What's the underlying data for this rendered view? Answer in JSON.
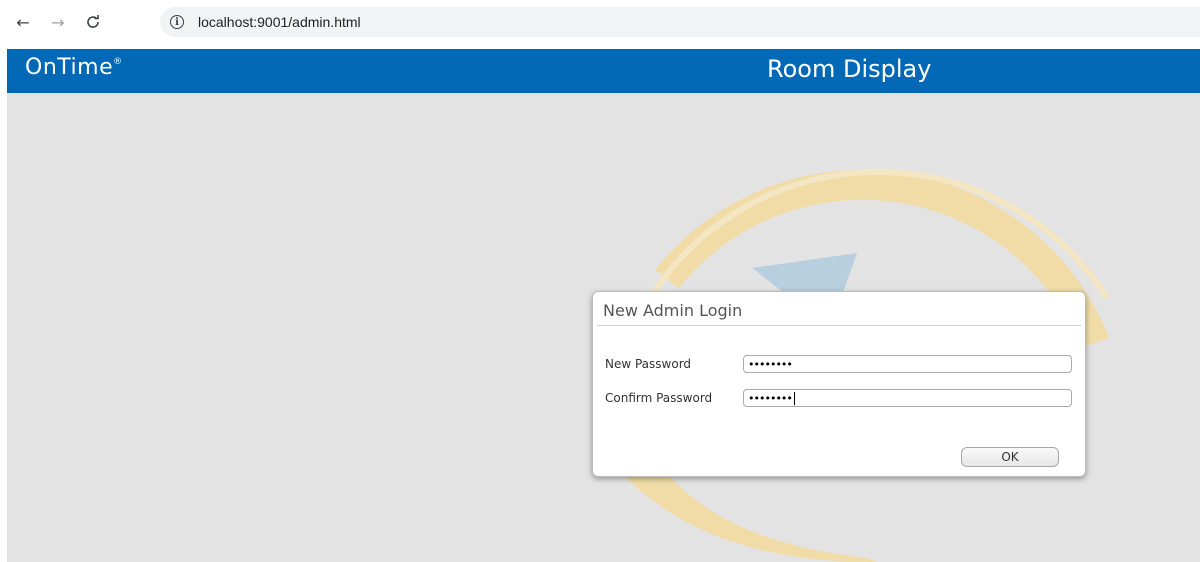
{
  "browser": {
    "back_icon": "←",
    "forward_icon": "→",
    "reload_icon": "C",
    "info_icon": "i",
    "url": "localhost:9001/admin.html"
  },
  "header": {
    "brand": "OnTime",
    "brand_mark": "®",
    "title": "Room Display",
    "background_color": "#0068b5"
  },
  "dialog": {
    "title": "New Admin Login",
    "fields": [
      {
        "label": "New Password",
        "value": "••••••••"
      },
      {
        "label": "Confirm Password",
        "value": "••••••••"
      }
    ],
    "ok_label": "OK"
  },
  "colors": {
    "content_background": "#e3e3e3",
    "watermark_gold": "#f1dca8",
    "watermark_blue": "#b7cfde"
  }
}
